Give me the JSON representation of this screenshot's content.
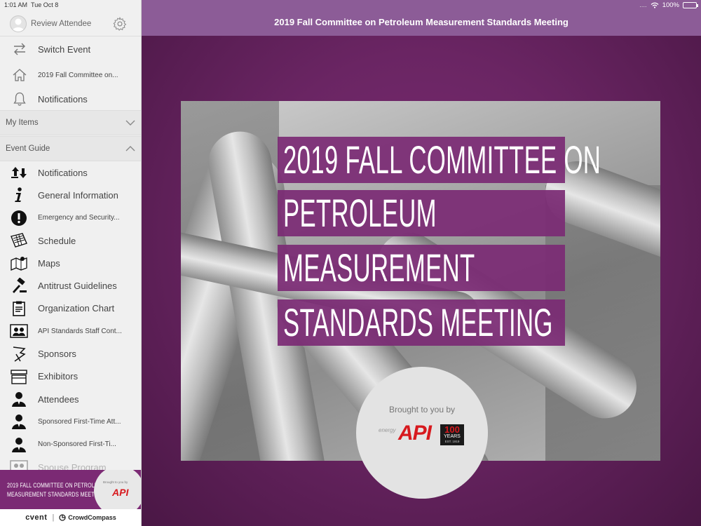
{
  "status_bar": {
    "time": "1:01 AM",
    "date": "Tue Oct 8",
    "signal": "....",
    "battery": "100%"
  },
  "sidebar": {
    "profile_name": "Review Attendee",
    "top_items": [
      {
        "label": "Switch Event",
        "icon": "switch-arrows-icon"
      },
      {
        "label": "2019 Fall Committee on...",
        "icon": "home-icon"
      },
      {
        "label": "Notifications",
        "icon": "bell-icon"
      }
    ],
    "my_items_label": "My Items",
    "event_guide_label": "Event Guide",
    "event_guide_items": [
      {
        "label": "Notifications",
        "icon": "notifications-arrows-icon"
      },
      {
        "label": "General Information",
        "icon": "info-icon"
      },
      {
        "label": "Emergency and Security...",
        "icon": "exclamation-icon"
      },
      {
        "label": "Schedule",
        "icon": "calendar-icon"
      },
      {
        "label": "Maps",
        "icon": "map-icon"
      },
      {
        "label": "Antitrust Guidelines",
        "icon": "gavel-icon"
      },
      {
        "label": "Organization Chart",
        "icon": "clipboard-icon"
      },
      {
        "label": "API Standards Staff Cont...",
        "icon": "contacts-icon"
      },
      {
        "label": "Sponsors",
        "icon": "sponsor-flag-icon"
      },
      {
        "label": "Exhibitors",
        "icon": "booth-icon"
      },
      {
        "label": "Attendees",
        "icon": "person-icon"
      },
      {
        "label": "Sponsored First-Time Att...",
        "icon": "person-icon"
      },
      {
        "label": "Non-Sponsored First-Ti...",
        "icon": "person-icon"
      },
      {
        "label": "Spouse Program",
        "icon": "people-icon"
      }
    ],
    "banner": {
      "line1": "2019 FALL COMMITTEE ON PETROLEUM",
      "line2": "MEASUREMENT STANDARDS MEETING",
      "brought": "Brought to you by",
      "api": "API"
    },
    "footer": {
      "cvent": "cvent",
      "separator": "|",
      "crowdcompass": "CrowdCompass"
    }
  },
  "main": {
    "title": "2019 Fall Committee on Petroleum Measurement Standards Meeting",
    "banner_lines": [
      "2019 FALL COMMITTEE ON",
      "PETROLEUM",
      "MEASUREMENT",
      "STANDARDS MEETING"
    ],
    "brought_to_you": "Brought to you by",
    "logo": {
      "energy": "energy",
      "api": "API",
      "years_number": "100",
      "years_label": "YEARS",
      "est": "EST. 1919"
    }
  },
  "colors": {
    "brand_purple": "#7b2a74",
    "topbar": "#8c5c97",
    "api_red": "#d7191e"
  }
}
